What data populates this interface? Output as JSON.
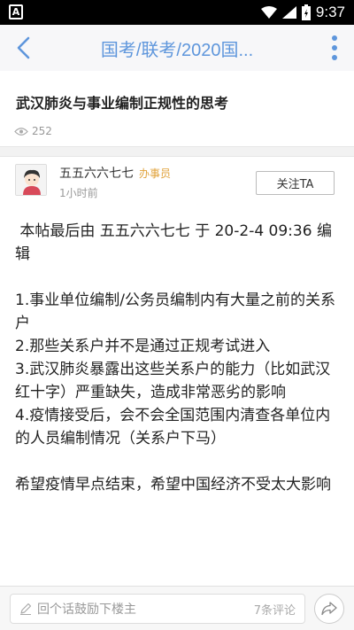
{
  "status_bar": {
    "time": "9:37",
    "app_glyph": "A"
  },
  "nav": {
    "title": "国考/联考/2020国..."
  },
  "post": {
    "title": "武汉肺炎与事业编制正规性的思考",
    "views": "252"
  },
  "author": {
    "name": "五五六六七七",
    "role": "办事员",
    "time": "1小时前",
    "follow_label": "关注TA"
  },
  "content": {
    "edit_note": " 本帖最后由 五五六六七七 于 20-2-4 09:36 编辑",
    "points": [
      "1.事业单位编制/公务员编制内有大量之前的关系户",
      "2.那些关系户并不是通过正规考试进入",
      "3.武汉肺炎暴露出这些关系户的能力（比如武汉红十字）严重缺失，造成非常恶劣的影响",
      "4.疫情接受后，会不会全国范围内清查各单位内的人员编制情况（关系户下马）"
    ],
    "closing": "希望疫情早点结束，希望中国经济不受太大影响"
  },
  "bottom": {
    "comment_placeholder": "回个话鼓励下楼主",
    "comment_count": "7条评论"
  },
  "icons": {
    "back": "back-arrow-icon",
    "more": "more-vertical-icon",
    "eye": "eye-icon",
    "pen": "pen-icon",
    "share": "share-icon"
  },
  "colors": {
    "accent": "#5e96dc",
    "role": "#e0a23a"
  }
}
